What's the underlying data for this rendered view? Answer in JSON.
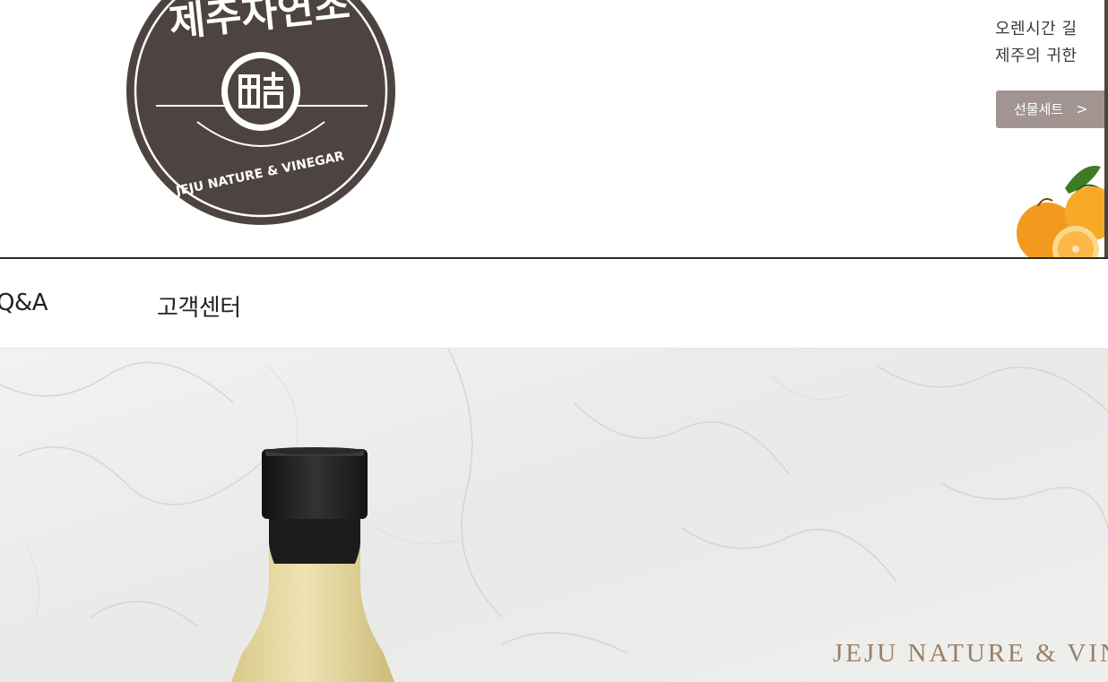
{
  "logo": {
    "arc_text": "제주자연초",
    "center_mark": "醋",
    "ring_text": "JEJU NATURE & VINEGAR"
  },
  "side_banner": {
    "line1": "오렌시간 길",
    "line2": "제주의 귀한",
    "button_label": "선물세트",
    "button_chevron": ">"
  },
  "nav": {
    "items": [
      {
        "label": "Q&A"
      },
      {
        "label": "고객센터"
      }
    ]
  },
  "hero": {
    "tagline": "JEJU NATURE & VIN"
  },
  "colors": {
    "logo_brown": "#4d4441",
    "button_bg": "#a19491",
    "orange": "#f39a1e",
    "tagline": "#9a7f66",
    "bottle_cap": "#1f1f1f",
    "bottle_body": "#e8dba6"
  }
}
